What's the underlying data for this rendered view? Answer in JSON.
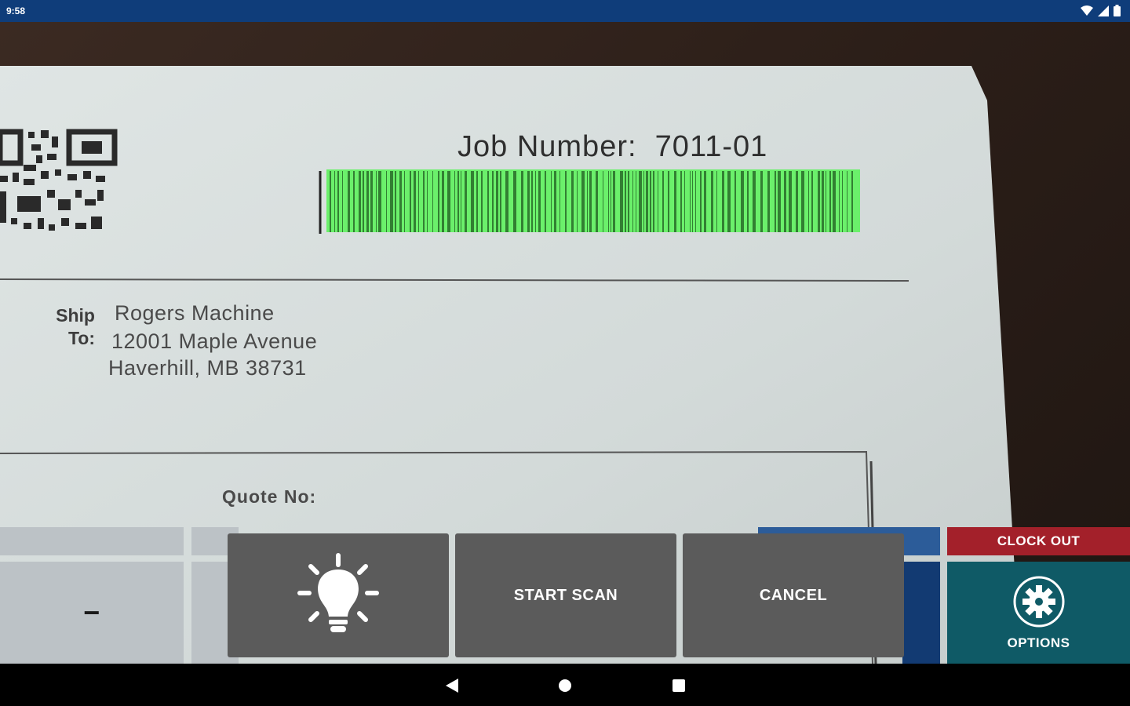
{
  "status_bar": {
    "time": "9:58",
    "icons": [
      "wifi-icon",
      "signal-icon",
      "battery-icon"
    ]
  },
  "document": {
    "job_number_label": "Job Number:",
    "job_number_value": "7011-01",
    "ship_label_line1": "Ship",
    "ship_label_line2": "To:",
    "ship_to": [
      "Rogers Machine",
      "12001 Maple Avenue",
      "Haverhill, MB 38731"
    ],
    "quote_label": "Quote No:",
    "barcode_highlight_color": "#6bf06b"
  },
  "actions": {
    "minus_label": "−",
    "flashlight_icon": "lightbulb-icon",
    "start_scan_label": "START SCAN",
    "cancel_label": "CANCEL",
    "clock_out_label": "CLOCK OUT",
    "options_label": "OPTIONS",
    "options_icon": "gear-icon"
  },
  "colors": {
    "status_bar": "#0f3d7a",
    "clock_out": "#a3202a",
    "options": "#0f5a66",
    "action_button": "#5b5b5b"
  },
  "nav": [
    "back-icon",
    "home-icon",
    "recents-icon"
  ]
}
